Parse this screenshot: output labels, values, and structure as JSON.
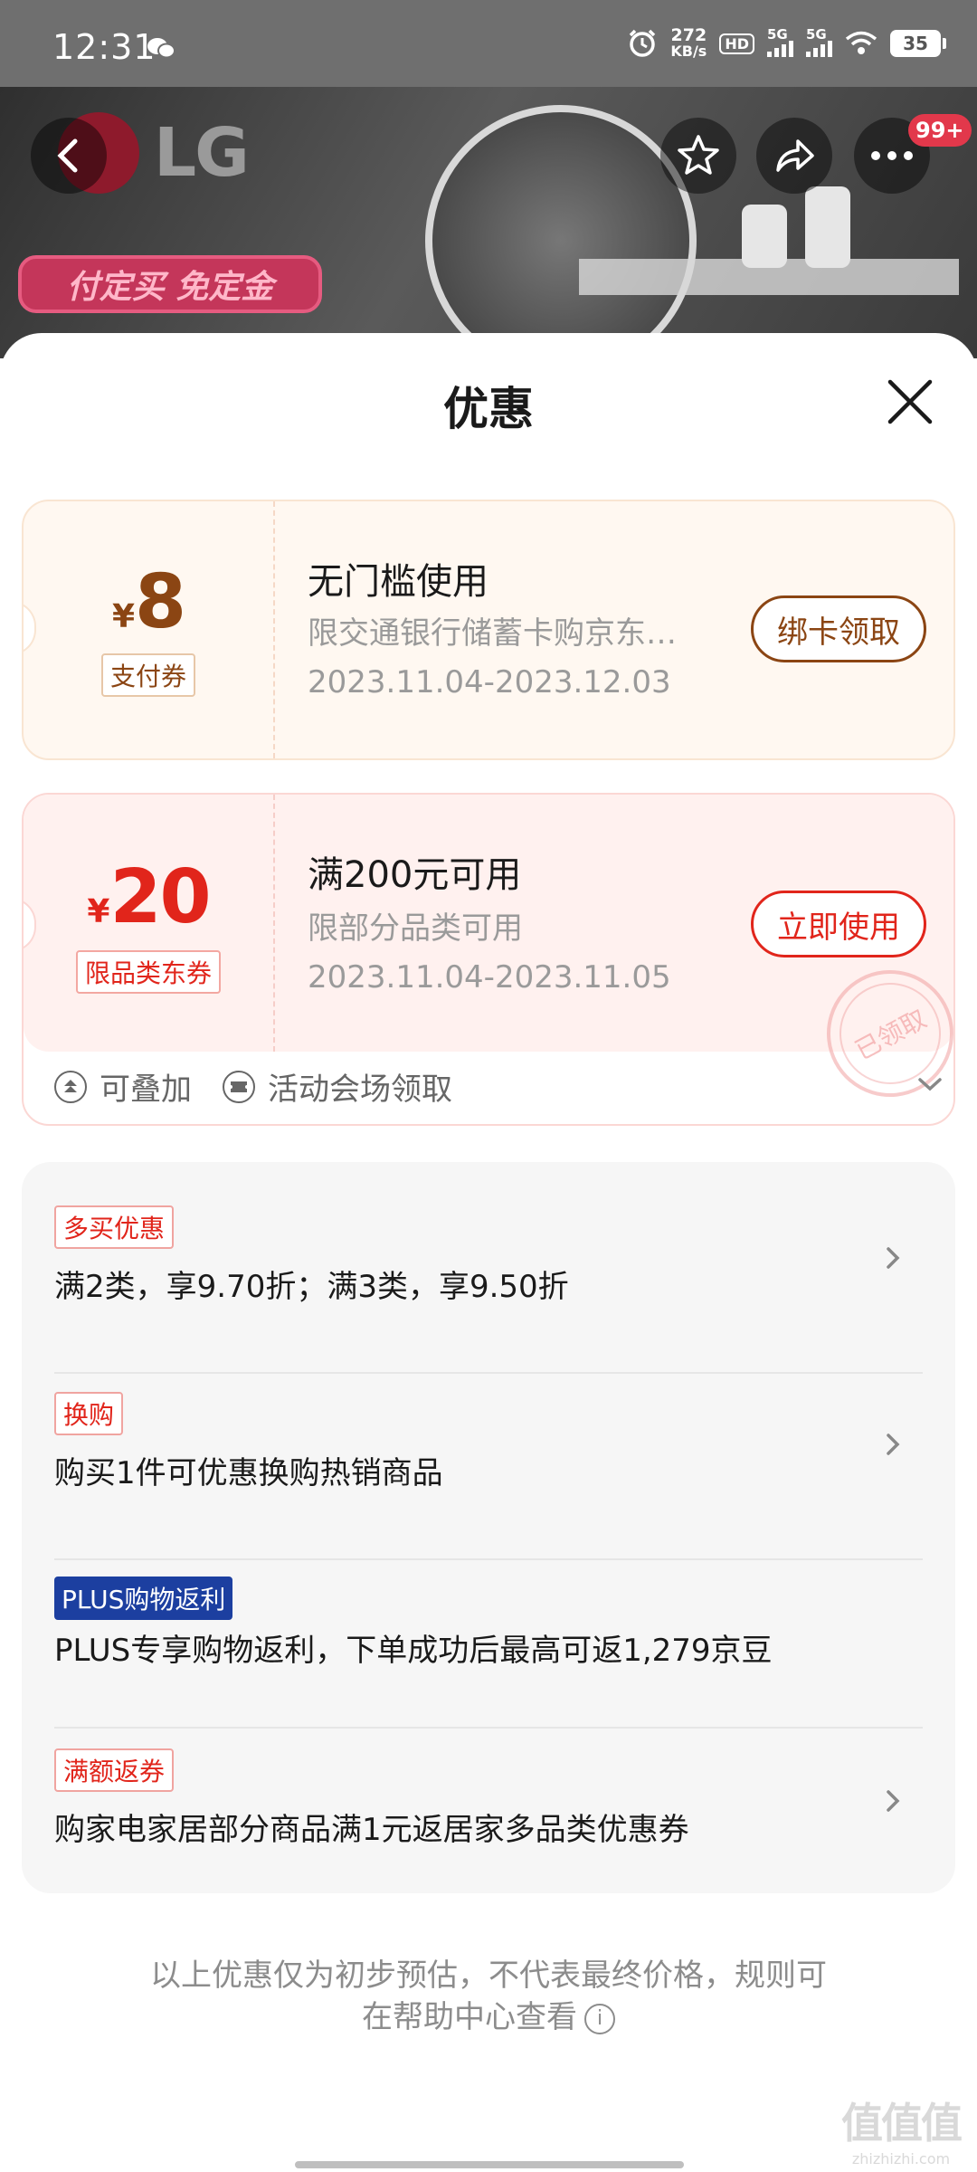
{
  "status_bar": {
    "time": "12:31",
    "net_speed_value": "272",
    "net_speed_unit": "KB/s",
    "hd_label": "HD",
    "signal1": "5G",
    "signal2": "5G",
    "battery": "35"
  },
  "product_header": {
    "brand": "LG",
    "promo_banner": "付定买 免定金",
    "more_badge": "99+"
  },
  "sheet": {
    "title": "优惠"
  },
  "coupons": [
    {
      "currency": "¥",
      "amount": "8",
      "type_tag": "支付券",
      "title": "无门槛使用",
      "subtitle": "限交通银行储蓄卡购京东…",
      "date_range": "2023.11.04-2023.12.03",
      "button": "绑卡领取"
    },
    {
      "currency": "¥",
      "amount": "20",
      "type_tag": "限品类东券",
      "title": "满200元可用",
      "subtitle": "限部分品类可用",
      "date_range": "2023.11.04-2023.11.05",
      "button": "立即使用",
      "stamp": "已领取",
      "footer": {
        "stackable": "可叠加",
        "source": "活动会场领取"
      }
    }
  ],
  "promotions": [
    {
      "tag": "多买优惠",
      "text": "满2类，享9.70折；满3类，享9.50折",
      "has_arrow": true
    },
    {
      "tag": "换购",
      "text": "购买1件可优惠换购热销商品",
      "has_arrow": true
    },
    {
      "tag": "PLUS购物返利",
      "text": "PLUS专享购物返利，下单成功后最高可返1,279京豆",
      "has_arrow": false,
      "tag_style": "plus"
    },
    {
      "tag": "满额返券",
      "text": "购家电家居部分商品满1元返居家多品类优惠券",
      "has_arrow": true
    }
  ],
  "disclaimer": {
    "line1": "以上优惠仅为初步预估，不代表最终价格，规则可",
    "line2": "在帮助中心查看"
  },
  "watermark": {
    "big": "值值值",
    "small": "zhizhizhi.com"
  },
  "colors": {
    "pay_coupon_accent": "#8b4513",
    "jd_coupon_accent": "#e1251b",
    "plus_tag_bg": "#1c3fa0"
  }
}
